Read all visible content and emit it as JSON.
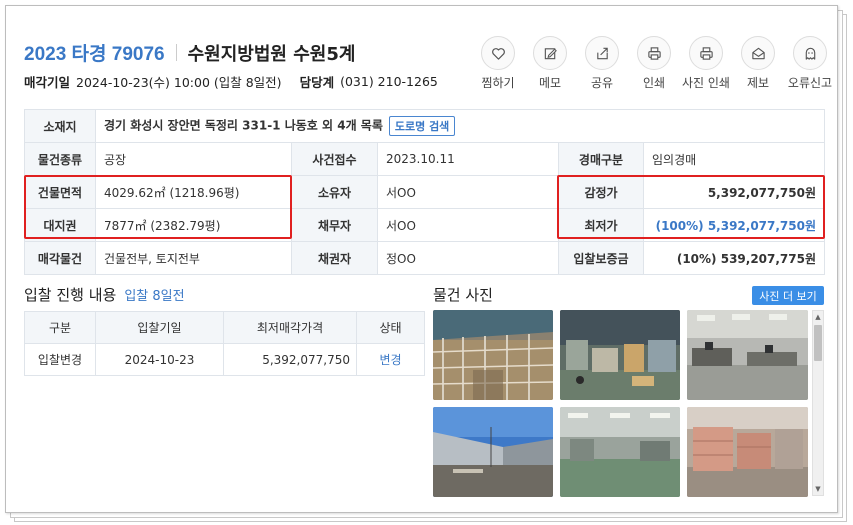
{
  "header": {
    "case_number": "2023 타경 79076",
    "court": "수원지방법원 수원5계",
    "sale_date_label": "매각기일",
    "sale_date_value": "2024-10-23(수) 10:00 (입찰 8일전)",
    "dept_label": "담당계",
    "dept_value": "(031) 210-1265"
  },
  "actions": [
    {
      "label": "찜하기",
      "icon": "heart-icon"
    },
    {
      "label": "메모",
      "icon": "memo-icon"
    },
    {
      "label": "공유",
      "icon": "share-icon"
    },
    {
      "label": "인쇄",
      "icon": "print-icon"
    },
    {
      "label": "사진 인쇄",
      "icon": "photo-print-icon"
    },
    {
      "label": "제보",
      "icon": "report-icon"
    },
    {
      "label": "오류신고",
      "icon": "ghost-icon"
    }
  ],
  "property": {
    "address_label": "소재지",
    "address_value": "경기 화성시 장안면 독정리 331-1 나동호 외 4개 목록",
    "road_button": "도로명 검색",
    "type_label": "물건종류",
    "type_value": "공장",
    "received_label": "사건접수",
    "received_value": "2023.10.11",
    "auction_type_label": "경매구분",
    "auction_type_value": "임의경매",
    "building_area_label": "건물면적",
    "building_area_value": "4029.62㎡ (1218.96평)",
    "owner_label": "소유자",
    "owner_value": "서OO",
    "appraisal_label": "감정가",
    "appraisal_value": "5,392,077,750원",
    "land_right_label": "대지권",
    "land_right_value": "7877㎡ (2382.79평)",
    "debtor_label": "채무자",
    "debtor_value": "서OO",
    "minimum_label": "최저가",
    "minimum_value": "(100%) 5,392,077,750원",
    "sale_item_label": "매각물건",
    "sale_item_value": "건물전부, 토지전부",
    "creditor_label": "채권자",
    "creditor_value": "정OO",
    "deposit_label": "입찰보증금",
    "deposit_value": "(10%) 539,207,775원"
  },
  "bidding": {
    "title": "입찰 진행 내용",
    "subtitle": "입찰 8일전",
    "headers": [
      "구분",
      "입찰기일",
      "최저매각가격",
      "상태"
    ],
    "rows": [
      {
        "type": "입찰변경",
        "date": "2024-10-23",
        "price": "5,392,077,750",
        "status": "변경"
      }
    ]
  },
  "photos": {
    "title": "물건 사진",
    "more_button": "사진 더 보기"
  },
  "colors": {
    "accent": "#3a78c6",
    "highlight": "#e02020",
    "header_bg": "#f3f6f9",
    "button_blue": "#3a8ee6"
  }
}
